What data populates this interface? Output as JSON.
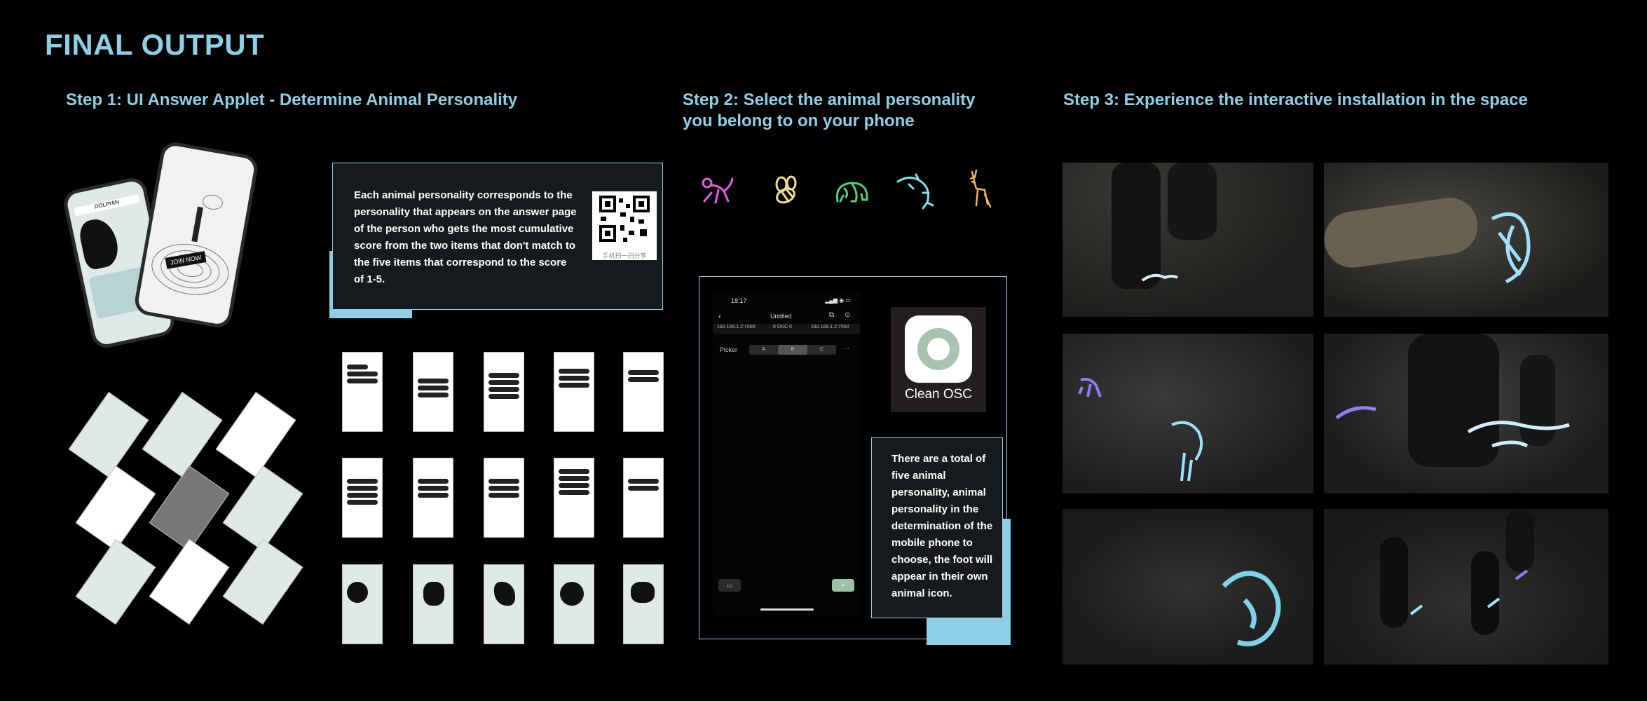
{
  "page": {
    "title": "FINAL OUTPUT"
  },
  "steps": [
    {
      "label": "Step 1: UI Answer Applet - Determine Animal Personality"
    },
    {
      "label": "Step 2: Select the animal personality you belong to on your phone"
    },
    {
      "label": "Step 3: Experience the interactive installation in the space"
    }
  ],
  "step1": {
    "description": "Each animal personality corresponds to the personality that appears on the answer page of the person who gets the most cumulative score from the two items that don't match to the five items that correspond to the score of 1-5.",
    "qr_caption": "手机扫一扫分享",
    "phone_button": "JOIN NOW",
    "phone_header": "DOLPHIN"
  },
  "step2": {
    "animals": [
      {
        "name": "monkey-icon",
        "color": "#e35de0"
      },
      {
        "name": "bee-icon",
        "color": "#f0dc9a"
      },
      {
        "name": "elephant-icon",
        "color": "#52d07a"
      },
      {
        "name": "dolphin-icon",
        "color": "#7fe3f0"
      },
      {
        "name": "deer-icon",
        "color": "#f0b55a"
      }
    ],
    "app": {
      "time": "18:17",
      "doc_title": "Untitled",
      "ip_left": "192.168.1.2:7000",
      "osc_status": "0 OSC 0",
      "ip_right": "192.168.1.2:7000",
      "picker_label": "Picker",
      "options": [
        "A",
        "B",
        "C"
      ],
      "selected": "B",
      "more": "···"
    },
    "clean_osc_label": "Clean OSC",
    "description": "There are a total of five animal personality, animal personality in the determination of the mobile phone to choose, the foot will appear in their own animal icon."
  },
  "colors": {
    "accent": "#8fcfe6",
    "panel": "#151b1c",
    "glow_blue": "#9fe0ff",
    "glow_purple": "#8f7dff"
  }
}
